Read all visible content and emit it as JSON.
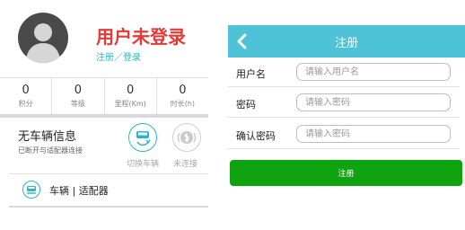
{
  "profile": {
    "title": "用户未登录",
    "sublink": "注册／登录",
    "stats": [
      {
        "value": "0",
        "label": "积分"
      },
      {
        "value": "0",
        "label": "等级"
      },
      {
        "value": "0",
        "label": "里程(Km)"
      },
      {
        "value": "0",
        "label": "时长(h)"
      }
    ]
  },
  "vehicle": {
    "title": "无车辆信息",
    "subtitle": "已断开与适配器连接",
    "switch_label": "切换车辆",
    "status_label": "未连接",
    "menu_label": "车辆 | 适配器"
  },
  "register": {
    "header_title": "注册",
    "fields": [
      {
        "label": "用户名",
        "placeholder": "请输入用户名"
      },
      {
        "label": "密码",
        "placeholder": "请输入密码"
      },
      {
        "label": "确认密码",
        "placeholder": "请输入密码"
      }
    ],
    "submit_label": "注册"
  },
  "colors": {
    "accent": "#4ec3d8",
    "title_red": "#e53935",
    "submit_green": "#0fa30f"
  }
}
